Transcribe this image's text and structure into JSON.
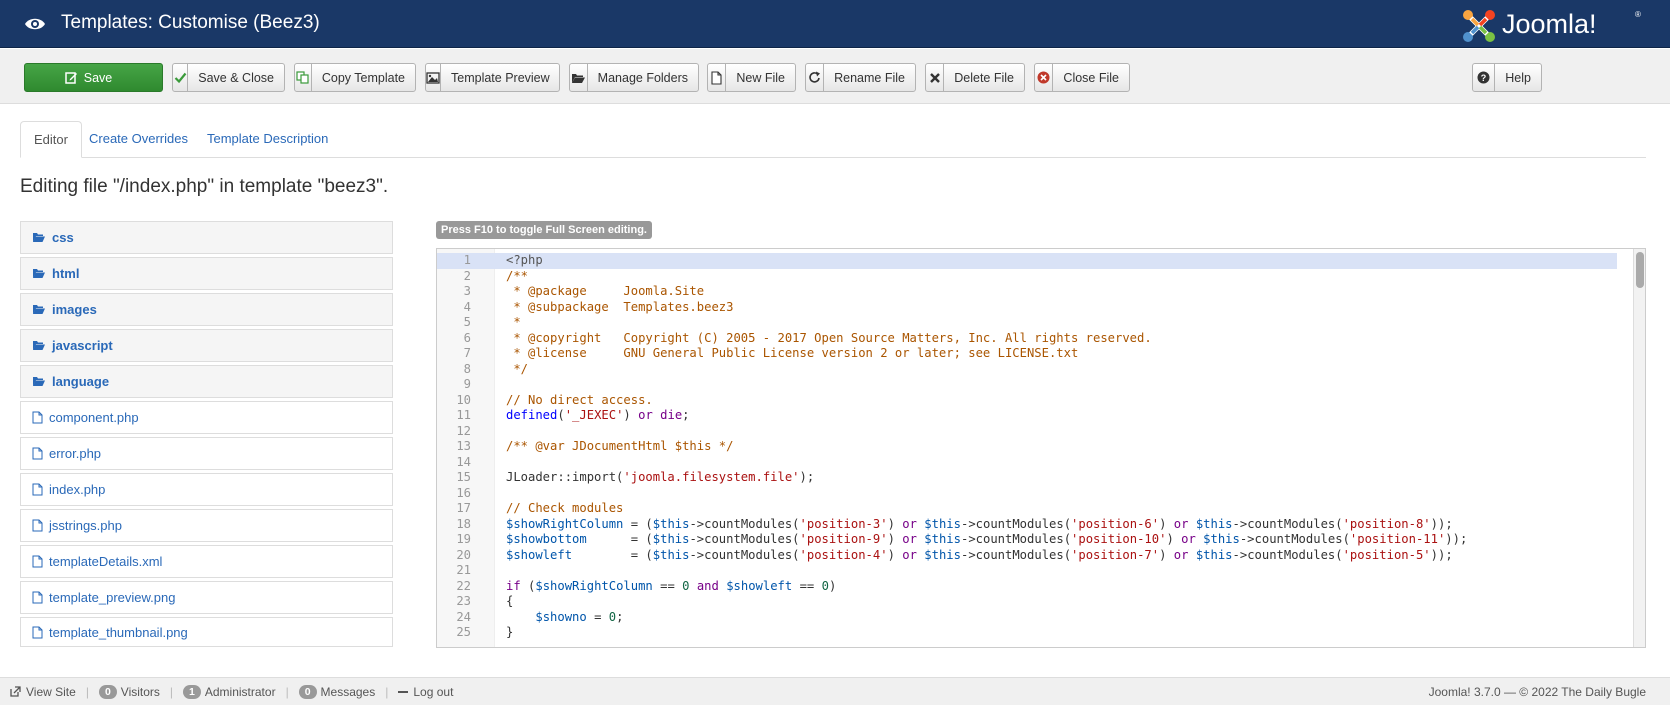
{
  "header": {
    "title": "Templates: Customise (Beez3)",
    "logo_text": "Joomla!",
    "logo_mark": "®"
  },
  "toolbar": {
    "save": "Save",
    "save_close": "Save & Close",
    "copy_template": "Copy Template",
    "template_preview": "Template Preview",
    "manage_folders": "Manage Folders",
    "new_file": "New File",
    "rename_file": "Rename File",
    "delete_file": "Delete File",
    "close_file": "Close File",
    "help": "Help"
  },
  "tabs": [
    "Editor",
    "Create Overrides",
    "Template Description"
  ],
  "heading": "Editing file \"/index.php\" in template \"beez3\".",
  "tree": {
    "folders": [
      "css",
      "html",
      "images",
      "javascript",
      "language"
    ],
    "files": [
      "component.php",
      "error.php",
      "index.php",
      "jsstrings.php",
      "templateDetails.xml",
      "template_preview.png",
      "template_thumbnail.png"
    ]
  },
  "editor": {
    "hint": "Press F10 to toggle Full Screen editing.",
    "line_numbers": [
      "1",
      "2",
      "3",
      "4",
      "5",
      "6",
      "7",
      "8",
      "9",
      "10",
      "11",
      "12",
      "13",
      "14",
      "15",
      "16",
      "17",
      "18",
      "19",
      "20",
      "21",
      "22",
      "23",
      "24",
      "25"
    ],
    "lines": {
      "l1": "<?php",
      "l2": "/**",
      "l3": " * @package     Joomla.Site",
      "l4": " * @subpackage  Templates.beez3",
      "l5": " *",
      "l6": " * @copyright   Copyright (C) 2005 - 2017 Open Source Matters, Inc. All rights reserved.",
      "l7": " * @license     GNU General Public License version 2 or later; see LICENSE.txt",
      "l8": " */",
      "l9": "",
      "l10": "// No direct access.",
      "l12": "",
      "l13": "/** @var JDocumentHtml $this */",
      "l14": "",
      "l16": "",
      "l17": "// Check modules",
      "l21": ""
    },
    "tokens": {
      "defined": "defined",
      "jexec": "'_JEXEC'",
      "or": "or",
      "die": "die",
      "jloader": "JLoader::import(",
      "jfile": "'joomla.filesystem.file'",
      "close_paren_semi": ");",
      "showRightColumn": "$showRightColumn",
      "showbottom": "$showbottom",
      "showleft": "$showleft",
      "showno": "$showno",
      "this": "$this",
      "count": "->countModules(",
      "p3": "'position-3'",
      "p6": "'position-6'",
      "p8": "'position-8'",
      "p9": "'position-9'",
      "p10": "'position-10'",
      "p11": "'position-11'",
      "p4": "'position-4'",
      "p7": "'position-7'",
      "p5": "'position-5'",
      "if": "if",
      "and": "and",
      "zero": "0"
    }
  },
  "status": {
    "view_site": "View Site",
    "visitors_count": "0",
    "visitors": "Visitors",
    "admin_count": "1",
    "admin": "Administrator",
    "messages_count": "0",
    "messages": "Messages",
    "logout": "Log out",
    "footer": "Joomla! 3.7.0  —  © 2022 The Daily Bugle"
  },
  "colors": {
    "header_bg": "#1a3867",
    "save_green": "#46a546",
    "link_blue": "#2a69b8"
  }
}
